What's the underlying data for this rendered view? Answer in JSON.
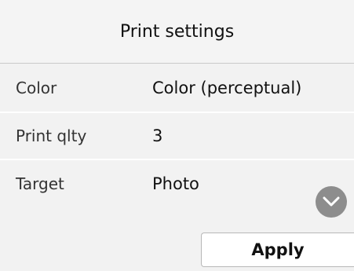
{
  "header": {
    "title": "Print settings"
  },
  "settings": [
    {
      "label": "Color",
      "value": "Color (perceptual)"
    },
    {
      "label": "Print qlty",
      "value": "3"
    },
    {
      "label": "Target",
      "value": "Photo"
    }
  ],
  "actions": {
    "apply_label": "Apply",
    "scroll_down_icon": "chevron-down-icon"
  },
  "colors": {
    "background": "#f2f2f2",
    "divider": "#ffffff",
    "button_gray": "#8d8d8d",
    "text": "#111111"
  }
}
